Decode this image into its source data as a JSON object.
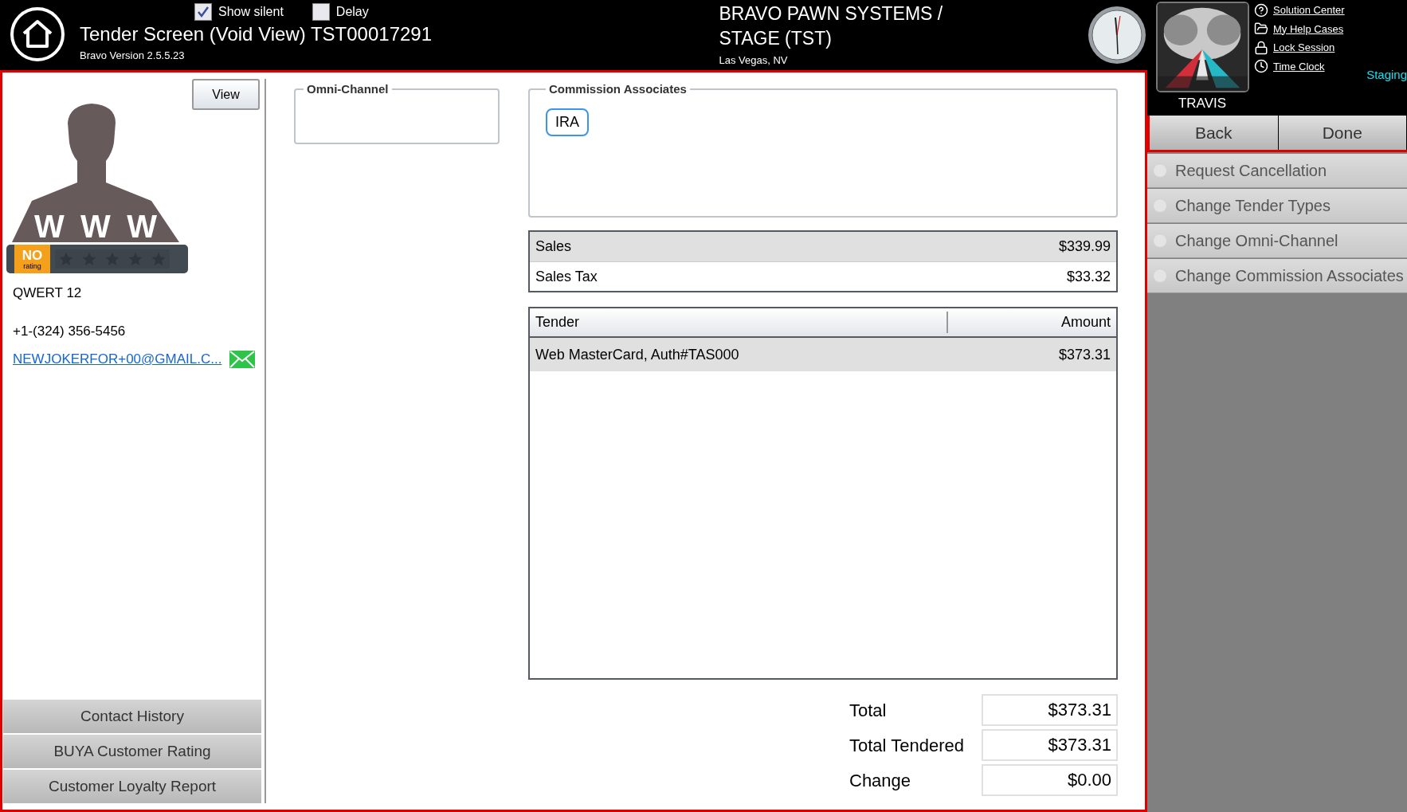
{
  "header": {
    "title": "Tender Screen (Void View) TST00017291",
    "version": "Bravo Version 2.5.5.23",
    "checkboxes": [
      {
        "label": "Show silent",
        "checked": true
      },
      {
        "label": "Delay",
        "checked": false
      }
    ],
    "company": "BRAVO PAWN SYSTEMS / STAGE (TST)",
    "location": "Las Vegas, NV",
    "user": "TRAVIS",
    "links": [
      {
        "label": "Solution Center"
      },
      {
        "label": "My Help Cases"
      },
      {
        "label": "Lock Session"
      },
      {
        "label": "Time Clock"
      }
    ],
    "environment": "Staging"
  },
  "customer": {
    "view_button": "View",
    "avatar_letters": [
      "W",
      "W",
      "W"
    ],
    "rating": {
      "badge": "NO",
      "badge_sub": "rating",
      "stars": 0
    },
    "name": "QWERT 12",
    "phone": "+1-(324) 356-5456",
    "email": "NEWJOKERFOR+00@GMAIL.C...",
    "buttons": [
      "Contact History",
      "BUYA Customer Rating",
      "Customer Loyalty Report"
    ]
  },
  "omni_channel": {
    "legend": "Omni-Channel"
  },
  "commission_associates": {
    "legend": "Commission Associates",
    "associates": [
      "IRA"
    ]
  },
  "summary": [
    {
      "label": "Sales",
      "value": "$339.99"
    },
    {
      "label": "Sales Tax",
      "value": "$33.32"
    }
  ],
  "tender_table": {
    "columns": [
      "Tender",
      "Amount"
    ],
    "rows": [
      {
        "tender": "Web MasterCard, Auth#TAS000",
        "amount": "$373.31",
        "selected": true
      }
    ]
  },
  "totals": [
    {
      "label": "Total",
      "value": "$373.31"
    },
    {
      "label": "Total Tendered",
      "value": "$373.31"
    },
    {
      "label": "Change",
      "value": "$0.00"
    }
  ],
  "nav_buttons": [
    "Back",
    "Done"
  ],
  "actions": [
    {
      "label": "Request Cancellation",
      "checked": false
    },
    {
      "label": "Change Tender Types",
      "checked": false
    },
    {
      "label": "Change Omni-Channel",
      "checked": false
    },
    {
      "label": "Change Commission Associates",
      "checked": false
    }
  ]
}
